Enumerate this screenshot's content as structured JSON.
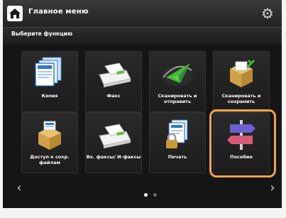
{
  "header": {
    "title": "Главное меню"
  },
  "subheader": {
    "label": "Выберите функцию"
  },
  "tiles": [
    {
      "label": "Копия"
    },
    {
      "label": "Факс"
    },
    {
      "label": "Сканировать и отправить"
    },
    {
      "label": "Сканировать и сохранить"
    },
    {
      "label": "Доступ к сохр. файлам"
    },
    {
      "label": "Вх. факсы/ И-факсы"
    },
    {
      "label": "Печать"
    },
    {
      "label": "Пособие"
    }
  ],
  "navigation": {
    "current_page": 1,
    "total_pages": 2
  },
  "colors": {
    "background": "#151515",
    "highlight": "#f0a54a"
  }
}
